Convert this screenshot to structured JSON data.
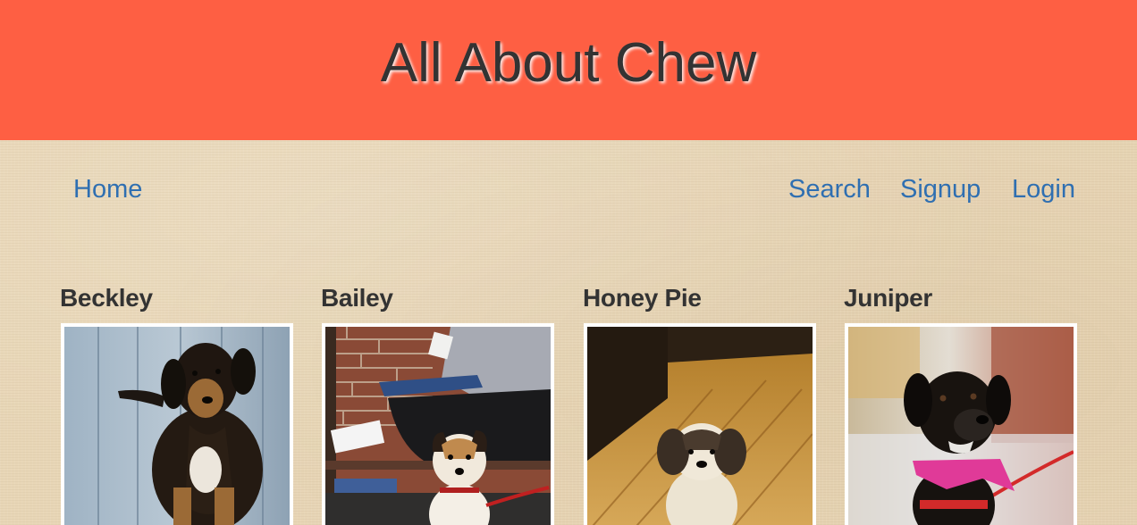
{
  "header": {
    "title": "All About Chew",
    "background_color": "#fe5f43"
  },
  "nav": {
    "left": [
      {
        "label": "Home"
      }
    ],
    "right": [
      {
        "label": "Search"
      },
      {
        "label": "Signup"
      },
      {
        "label": "Login"
      }
    ],
    "link_color": "#2f6fb1"
  },
  "dogs": [
    {
      "name": "Beckley",
      "photo": "dog-photo-beckley"
    },
    {
      "name": "Bailey",
      "photo": "dog-photo-bailey"
    },
    {
      "name": "Honey Pie",
      "photo": "dog-photo-honey-pie"
    },
    {
      "name": "Juniper",
      "photo": "dog-photo-juniper"
    }
  ]
}
